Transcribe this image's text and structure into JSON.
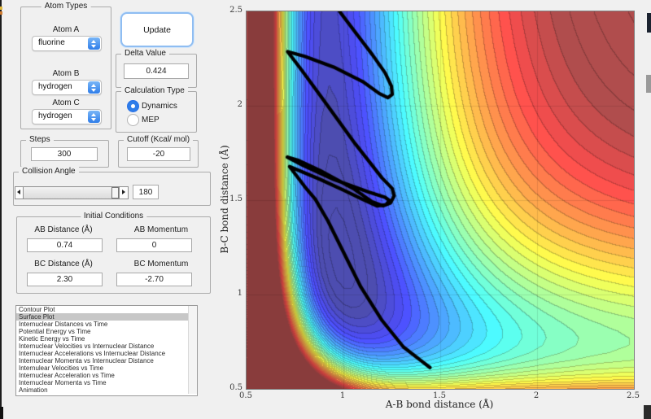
{
  "panel": {
    "atom_types": {
      "title": "Atom Types",
      "atoms": [
        {
          "label": "Atom A",
          "value": "fluorine"
        },
        {
          "label": "Atom B",
          "value": "hydrogen"
        },
        {
          "label": "Atom C",
          "value": "hydrogen"
        }
      ]
    },
    "update_label": "Update",
    "delta": {
      "title": "Delta Value",
      "value": "0.424"
    },
    "calc_type": {
      "title": "Calculation Type",
      "options": [
        {
          "label": "Dynamics",
          "selected": true
        },
        {
          "label": "MEP",
          "selected": false
        }
      ]
    },
    "steps": {
      "title": "Steps",
      "value": "300"
    },
    "cutoff": {
      "title": "Cutoff (Kcal/ mol)",
      "value": "-20"
    },
    "collision": {
      "title": "Collision Angle",
      "value": "180"
    },
    "initial": {
      "title": "Initial Conditions",
      "fields": [
        {
          "label": "AB Distance (Å)",
          "value": "0.74"
        },
        {
          "label": "AB Momentum",
          "value": "0"
        },
        {
          "label": "BC Distance (Å)",
          "value": "2.30"
        },
        {
          "label": "BC Momentum",
          "value": "-2.70"
        }
      ]
    },
    "plot_list": {
      "selected_index": 1,
      "items": [
        "Contour Plot",
        "Surface Plot",
        "Internuclear Distances vs Time",
        "Potential Energy vs Time",
        "Kinetic Energy vs Time",
        "Internuclear Velocities vs Internuclear Distance",
        "Internuclear Accelerations vs Internuclear Distance",
        "Internuclear Momenta vs Internuclear Distance",
        "Internulear Velocities vs Time",
        "Internuclear Acceleration vs Time",
        "Internuclear Momenta vs Time",
        "Animation"
      ]
    }
  },
  "chart_data": {
    "type": "heatmap",
    "subtype": "filled-contour-potential-energy-surface",
    "title": "",
    "xlabel": "A-B bond distance (Å)",
    "ylabel": "B-C bond distance (Å)",
    "xlim": [
      0.5,
      2.5
    ],
    "ylim": [
      0.5,
      2.5
    ],
    "xtick_labels": [
      "0.5",
      "1",
      "1.5",
      "2",
      "2.5"
    ],
    "ytick_labels": [
      "2.5",
      "2",
      "1.5",
      "1",
      "0.5"
    ],
    "gridlines": [
      1.0,
      1.5,
      2.0
    ],
    "grid": true,
    "colormap": "jet",
    "face_alpha": 0.7,
    "levels": 34,
    "clim_kcal": [
      -149,
      -20
    ],
    "cutoff_cap_kcal": -20,
    "surface_model": {
      "comment": "V(x,y)=M(x;D1,a1,re1)+M(y;D2,a2,re2)+K*exp(-b*(x+y)); M(r)=D*((1-exp(-a*(r-re)))^2-1)",
      "D1": 140,
      "a1": 2.3,
      "re1": 0.92,
      "D2": 80,
      "a2": 2.0,
      "re2": 0.74,
      "K": 5095,
      "b": 2.3
    },
    "trajectory": {
      "color": "#000000",
      "line_width": 4.2,
      "start_point": [
        0.74,
        2.3
      ],
      "end_point": [
        1.447,
        0.613
      ],
      "points": [
        [
          0.98,
          2.5
        ],
        [
          1.065,
          2.385
        ],
        [
          1.15,
          2.27
        ],
        [
          1.215,
          2.175
        ],
        [
          1.248,
          2.104
        ],
        [
          1.252,
          2.06
        ],
        [
          1.23,
          2.043
        ],
        [
          1.185,
          2.065
        ],
        [
          1.1,
          2.128
        ],
        [
          0.95,
          2.205
        ],
        [
          0.8,
          2.262
        ],
        [
          0.712,
          2.287
        ],
        [
          0.78,
          2.195
        ],
        [
          0.88,
          2.055
        ],
        [
          1.06,
          1.8
        ],
        [
          1.2,
          1.617
        ],
        [
          1.252,
          1.562
        ],
        [
          1.262,
          1.522
        ],
        [
          1.243,
          1.485
        ],
        [
          1.205,
          1.47
        ],
        [
          1.148,
          1.492
        ],
        [
          1.05,
          1.562
        ],
        [
          0.88,
          1.657
        ],
        [
          0.77,
          1.71
        ],
        [
          0.71,
          1.728
        ],
        [
          0.79,
          1.685
        ],
        [
          0.95,
          1.61
        ],
        [
          1.13,
          1.543
        ],
        [
          1.215,
          1.515
        ],
        [
          1.238,
          1.498
        ],
        [
          1.22,
          1.476
        ],
        [
          1.173,
          1.469
        ],
        [
          1.1,
          1.504
        ],
        [
          1.0,
          1.553
        ],
        [
          0.88,
          1.61
        ],
        [
          0.775,
          1.655
        ],
        [
          0.722,
          1.678
        ],
        [
          0.8,
          1.572
        ],
        [
          0.855,
          1.505
        ],
        [
          0.92,
          1.39
        ],
        [
          1.0,
          1.225
        ],
        [
          1.09,
          1.04
        ],
        [
          1.2,
          0.862
        ],
        [
          1.31,
          0.722
        ],
        [
          1.4,
          0.65
        ],
        [
          1.447,
          0.613
        ]
      ]
    }
  }
}
